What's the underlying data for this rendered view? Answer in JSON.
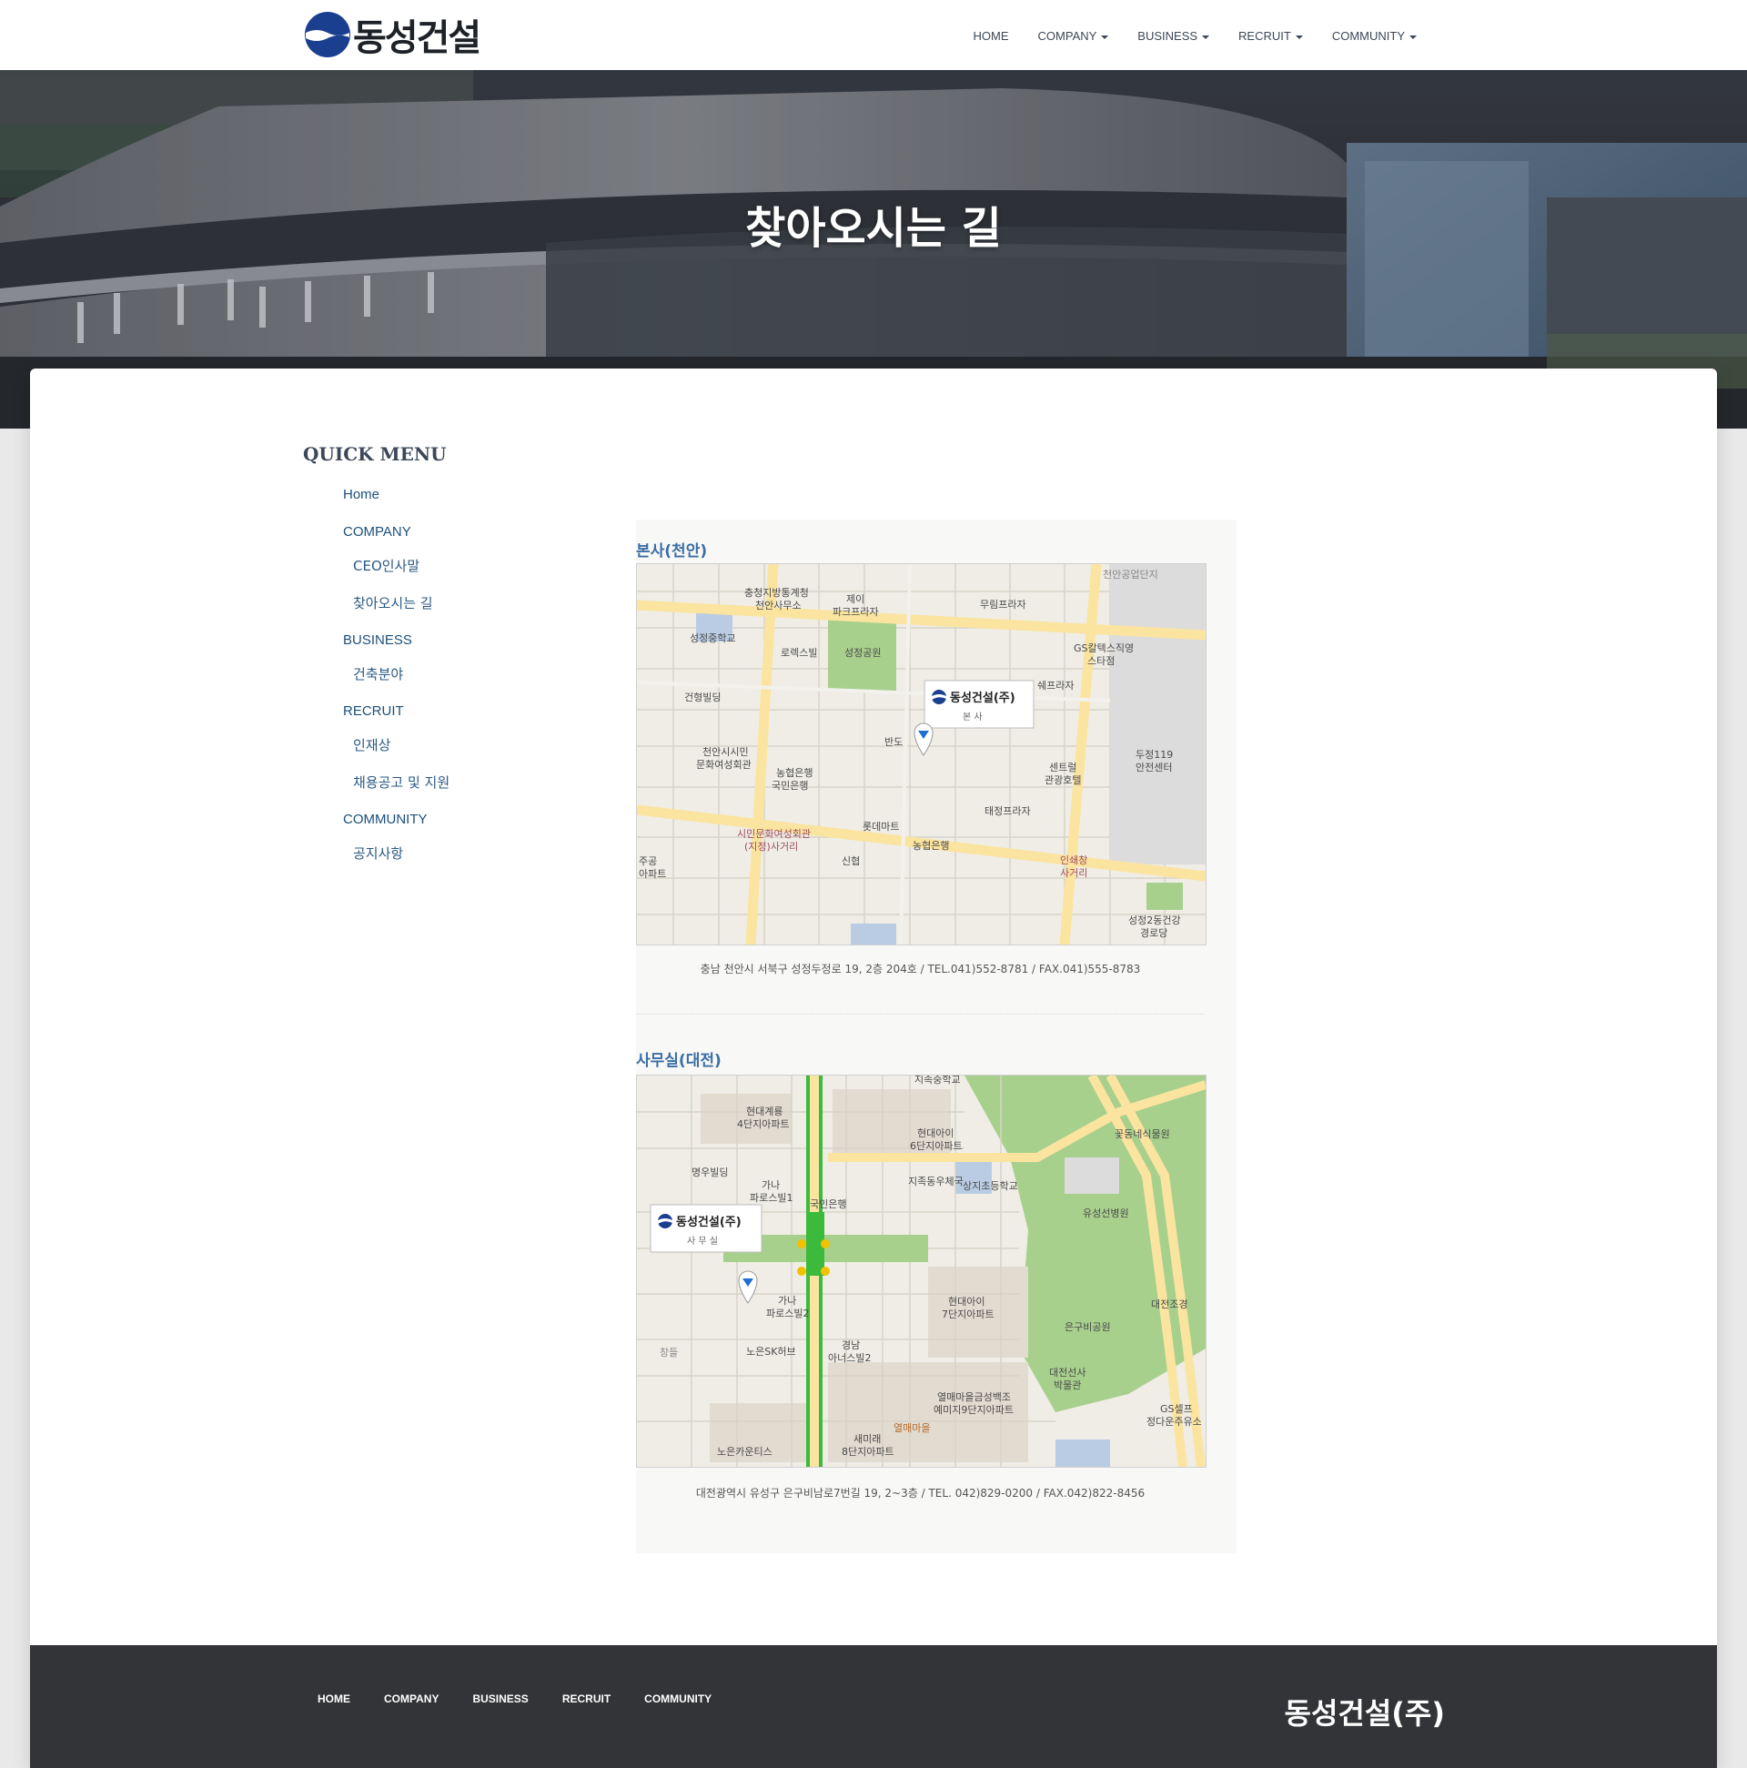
{
  "brand": {
    "name": "동성건설",
    "logo_icon": "dongsung-logo-icon"
  },
  "nav": {
    "items": [
      {
        "label": "HOME",
        "dropdown": false
      },
      {
        "label": "COMPANY",
        "dropdown": true
      },
      {
        "label": "BUSINESS",
        "dropdown": true
      },
      {
        "label": "RECRUIT",
        "dropdown": true
      },
      {
        "label": "COMMUNITY",
        "dropdown": true
      }
    ]
  },
  "hero": {
    "title": "찾아오시는 길"
  },
  "quick_menu": {
    "title": "QUICK MENU",
    "home": "Home",
    "company": {
      "label": "COMPANY",
      "ceo": "CEO인사말",
      "directions": "찾아오시는 길"
    },
    "business": {
      "label": "BUSINESS",
      "construction": "건축분야"
    },
    "recruit": {
      "label": "RECRUIT",
      "talent": "인재상",
      "jobs": "채용공고 및 지원"
    },
    "community": {
      "label": "COMMUNITY",
      "notice": "공지사항"
    }
  },
  "maps": {
    "head_office": {
      "title": "본사(천안)",
      "address": "충남 천안시 서북구 성정두정로 19, 2층 204호 / TEL.041)552-8781 / FAX.041)555-8783",
      "marker_company": "동성건설(주)",
      "marker_type": "본 사",
      "labels": {
        "l1": "충청지방통계청",
        "l1b": "천안사무소",
        "l2": "제이",
        "l2b": "파크프라자",
        "l3": "무림프라자",
        "l4": "천안공업단지",
        "l5": "성정중학교",
        "l6": "로렉스빌",
        "l7": "성정공원",
        "l8": "GS칼텍스직영",
        "l8b": "스타점",
        "l9": "건형빌딩",
        "l10": "쉐프라자",
        "l11": "반도",
        "l12": "천안시시민",
        "l12b": "문화여성회관",
        "l13": "농협은행",
        "l13b": "국민은행",
        "l14": "두정119",
        "l14b": "안전센터",
        "l15": "센트럴",
        "l15b": "관광호텔",
        "l16": "태정프라자",
        "l17": "롯데마트",
        "l18": "시민문화여성회관",
        "l18b": "(지정)사거리",
        "l19": "농협은행",
        "l20": "신협",
        "l21": "인쇄창",
        "l21b": "사거리",
        "l22": "성정2동건강",
        "l22b": "경로당",
        "l23": "주공",
        "l23b": "아파트"
      }
    },
    "office": {
      "title": "사무실(대전)",
      "address": "대전광역시 유성구 은구비남로7번길 19, 2~3층 / TEL. 042)829-0200 / FAX.042)822-8456",
      "marker_company": "동성건설(주)",
      "marker_type": "사 무 실",
      "labels": {
        "m1": "지족중학교",
        "m2": "현대계룡",
        "m2b": "4단지아파트",
        "m3": "현대아이",
        "m3b": "6단지아파트",
        "m4": "꽃동네식물원",
        "m5": "명우빌딩",
        "m6": "가나",
        "m6b": "파로스빌1",
        "m7": "국민은행",
        "m8": "지족동우체국",
        "m9": "상지초등학교",
        "m10": "유성선병원",
        "m11": "가나",
        "m11b": "파로스빌2",
        "m12": "현대아이",
        "m12b": "7단지아파트",
        "m13": "대전조경",
        "m14": "창들",
        "m15": "노은SK허브",
        "m16": "경남",
        "m16b": "아너스빌2",
        "m17": "은구비공원",
        "m18": "대전선사",
        "m18b": "박물관",
        "m19": "열매마을금성백조",
        "m19b": "예미지9단지아파트",
        "m20": "열매마을",
        "m21": "새미래",
        "m21b": "8단지아파트",
        "m22": "노은카운티스",
        "m23": "GS셀프",
        "m23b": "정다운주유소"
      }
    }
  },
  "footer": {
    "links": [
      "HOME",
      "COMPANY",
      "BUSINESS",
      "RECRUIT",
      "COMMUNITY"
    ],
    "company": "동성건설(주)"
  },
  "colors": {
    "link": "#1b4f7b",
    "map_title": "#3a6ea5",
    "footer_bg": "#323437",
    "road_yellow": "#fbe9a3",
    "park_green": "#a8d08d"
  }
}
